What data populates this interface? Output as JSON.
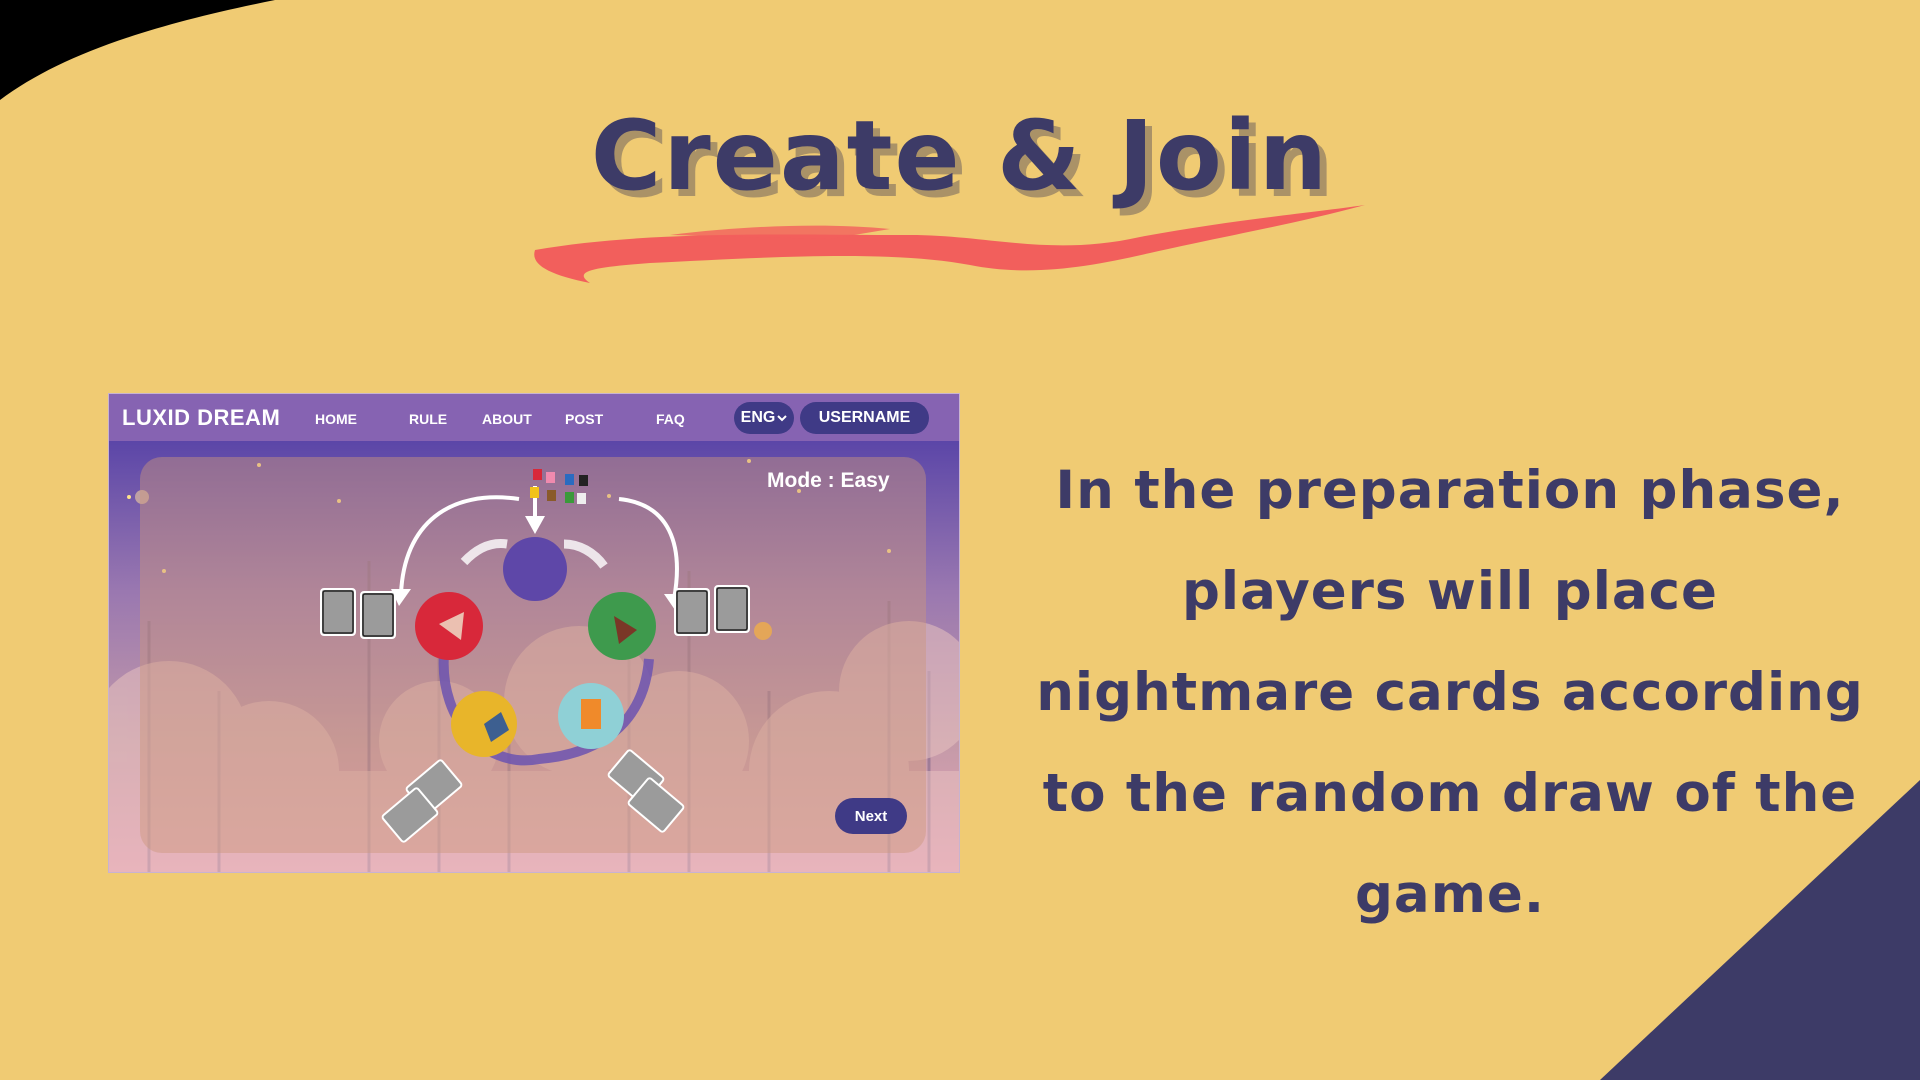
{
  "slide": {
    "title": "Create & Join",
    "description": "In the preparation phase, players will place nightmare cards according to the random draw of the game.",
    "colors": {
      "background": "#F0CB73",
      "text": "#3D3B67",
      "underline": "#F25F5C",
      "corner_top_left": "#000000",
      "corner_bottom_right": "#3D3B67"
    }
  },
  "screenshot": {
    "navbar": {
      "logo": "LUXID DREAM",
      "items": [
        "HOME",
        "RULE",
        "ABOUT",
        "POST",
        "FAQ"
      ],
      "language": "ENG",
      "language_icon": "chevron-down-icon",
      "username": "USERNAME"
    },
    "mode_label": "Mode : Easy",
    "next_button": "Next",
    "colors": {
      "navbar": "#8663B2",
      "button": "#3F3A86",
      "sky_top": "#5B46A8",
      "sky_bottom": "#E9A3B8"
    }
  }
}
